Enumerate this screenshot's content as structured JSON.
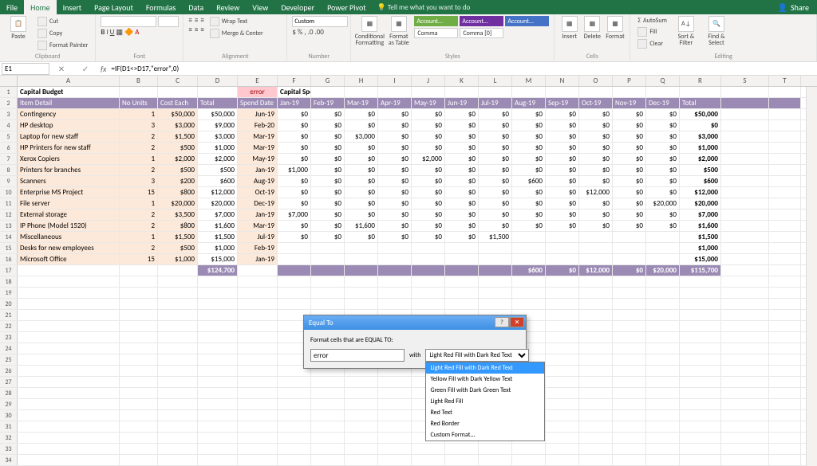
{
  "titlebar": {
    "tabs": [
      "File",
      "Home",
      "Insert",
      "Page Layout",
      "Formulas",
      "Data",
      "Review",
      "View",
      "Developer",
      "Power Pivot"
    ],
    "active_tab": 1,
    "tell_me": "Tell me what you want to do",
    "share": "Share"
  },
  "ribbon": {
    "clipboard": {
      "paste": "Paste",
      "cut": "Cut",
      "copy": "Copy",
      "format_painter": "Format Painter",
      "label": "Clipboard"
    },
    "font": {
      "label": "Font"
    },
    "alignment": {
      "wrap": "Wrap Text",
      "merge": "Merge & Center",
      "label": "Alignment"
    },
    "number": {
      "format": "Custom",
      "label": "Number"
    },
    "styles": {
      "cond_format": "Conditional Formatting",
      "format_table": "Format as Table",
      "accent_labels": [
        "Account...",
        "Account...",
        "Account...",
        "Comma",
        "Comma [0]"
      ],
      "accent_colors": [
        "#70ad47",
        "#7030a0",
        "#4472c4",
        "#ffffff",
        "#ffffff"
      ],
      "label": "Styles"
    },
    "cells": {
      "insert": "Insert",
      "delete": "Delete",
      "format": "Format",
      "label": "Cells"
    },
    "editing": {
      "autosum": "AutoSum",
      "fill": "Fill",
      "clear": "Clear",
      "sort": "Sort & Filter",
      "find": "Find & Select",
      "label": "Editing"
    }
  },
  "formula_bar": {
    "name": "E1",
    "formula": "=IF(D1<>D17,\"error\",0)"
  },
  "columns": [
    {
      "id": "A",
      "w": 128
    },
    {
      "id": "B",
      "w": 48
    },
    {
      "id": "C",
      "w": 50
    },
    {
      "id": "D",
      "w": 50
    },
    {
      "id": "E",
      "w": 50
    },
    {
      "id": "F",
      "w": 42
    },
    {
      "id": "G",
      "w": 42
    },
    {
      "id": "H",
      "w": 42
    },
    {
      "id": "I",
      "w": 42
    },
    {
      "id": "J",
      "w": 42
    },
    {
      "id": "K",
      "w": 42
    },
    {
      "id": "L",
      "w": 42
    },
    {
      "id": "M",
      "w": 42
    },
    {
      "id": "N",
      "w": 42
    },
    {
      "id": "O",
      "w": 42
    },
    {
      "id": "P",
      "w": 42
    },
    {
      "id": "Q",
      "w": 42
    },
    {
      "id": "R",
      "w": 52
    },
    {
      "id": "S",
      "w": 60
    },
    {
      "id": "T",
      "w": 40
    }
  ],
  "sheet": {
    "title_a": "Capital Budget",
    "title_f": "Capital Spend Schedule",
    "e1_error": "error",
    "headers": [
      "Item Detail",
      "No Units",
      "Cost Each",
      "Total",
      "Spend Date",
      "Jan-19",
      "Feb-19",
      "Mar-19",
      "Apr-19",
      "May-19",
      "Jun-19",
      "Jul-19",
      "Aug-19",
      "Sep-19",
      "Oct-19",
      "Nov-19",
      "Dec-19",
      "Total"
    ],
    "rows": [
      {
        "item": "Contingency",
        "units": 1,
        "cost": "$50,000",
        "total": "$50,000",
        "date": "Jun-19",
        "months": [
          "$0",
          "$0",
          "$0",
          "$0",
          "$0",
          "$0",
          "$0",
          "$0",
          "$0",
          "$0",
          "$0",
          "$0"
        ],
        "rtotal": "$50,000"
      },
      {
        "item": "HP desktop",
        "units": 3,
        "cost": "$3,000",
        "total": "$9,000",
        "date": "Feb-20",
        "months": [
          "$0",
          "$0",
          "$0",
          "$0",
          "$0",
          "$0",
          "$0",
          "$0",
          "$0",
          "$0",
          "$0",
          "$0"
        ],
        "rtotal": "$0"
      },
      {
        "item": "Laptop for new staff",
        "units": 2,
        "cost": "$1,500",
        "total": "$3,000",
        "date": "Mar-19",
        "months": [
          "$0",
          "$0",
          "$3,000",
          "$0",
          "$0",
          "$0",
          "$0",
          "$0",
          "$0",
          "$0",
          "$0",
          "$0"
        ],
        "rtotal": "$3,000"
      },
      {
        "item": "HP Printers for new staff",
        "units": 2,
        "cost": "$500",
        "total": "$1,000",
        "date": "Mar-19",
        "months": [
          "$0",
          "$0",
          "$0",
          "$0",
          "$0",
          "$0",
          "$0",
          "$0",
          "$0",
          "$0",
          "$0",
          "$0"
        ],
        "rtotal": "$1,000"
      },
      {
        "item": "Xerox Copiers",
        "units": 1,
        "cost": "$2,000",
        "total": "$2,000",
        "date": "May-19",
        "months": [
          "$0",
          "$0",
          "$0",
          "$0",
          "$2,000",
          "$0",
          "$0",
          "$0",
          "$0",
          "$0",
          "$0",
          "$0"
        ],
        "rtotal": "$2,000"
      },
      {
        "item": "Printers for branches",
        "units": 2,
        "cost": "$500",
        "total": "$500",
        "date": "Jan-19",
        "months": [
          "$1,000",
          "$0",
          "$0",
          "$0",
          "$0",
          "$0",
          "$0",
          "$0",
          "$0",
          "$0",
          "$0",
          "$0"
        ],
        "rtotal": "$500"
      },
      {
        "item": "Scanners",
        "units": 3,
        "cost": "$200",
        "total": "$600",
        "date": "Aug-19",
        "months": [
          "$0",
          "$0",
          "$0",
          "$0",
          "$0",
          "$0",
          "$0",
          "$600",
          "$0",
          "$0",
          "$0",
          "$0"
        ],
        "rtotal": "$600"
      },
      {
        "item": "Enterprise MS Project",
        "units": 15,
        "cost": "$800",
        "total": "$12,000",
        "date": "Oct-19",
        "months": [
          "$0",
          "$0",
          "$0",
          "$0",
          "$0",
          "$0",
          "$0",
          "$0",
          "$0",
          "$12,000",
          "$0",
          "$0"
        ],
        "rtotal": "$12,000"
      },
      {
        "item": "File server",
        "units": 1,
        "cost": "$20,000",
        "total": "$20,000",
        "date": "Dec-19",
        "months": [
          "$0",
          "$0",
          "$0",
          "$0",
          "$0",
          "$0",
          "$0",
          "$0",
          "$0",
          "$0",
          "$0",
          "$20,000"
        ],
        "rtotal": "$20,000"
      },
      {
        "item": "External storage",
        "units": 2,
        "cost": "$3,500",
        "total": "$7,000",
        "date": "Jan-19",
        "months": [
          "$7,000",
          "$0",
          "$0",
          "$0",
          "$0",
          "$0",
          "$0",
          "$0",
          "$0",
          "$0",
          "$0",
          "$0"
        ],
        "rtotal": "$7,000"
      },
      {
        "item": "IP Phone (Model 1520)",
        "units": 2,
        "cost": "$800",
        "total": "$1,600",
        "date": "Mar-19",
        "months": [
          "$0",
          "$0",
          "$1,600",
          "$0",
          "$0",
          "$0",
          "$0",
          "$0",
          "$0",
          "$0",
          "$0",
          "$0"
        ],
        "rtotal": "$1,600"
      },
      {
        "item": "Miscellaneous",
        "units": 1,
        "cost": "$1,500",
        "total": "$1,500",
        "date": "Jul-19",
        "months": [
          "$0",
          "$0",
          "$0",
          "$0",
          "$0",
          "$0",
          "$1,500",
          "",
          "",
          "",
          "",
          ""
        ],
        "rtotal": "$1,500"
      },
      {
        "item": "Desks for new employees",
        "units": 2,
        "cost": "$500",
        "total": "$1,000",
        "date": "Feb-19",
        "months": [
          "",
          "",
          "",
          "",
          "",
          "",
          "",
          "",
          "",
          "",
          "",
          ""
        ],
        "rtotal": "$1,000"
      },
      {
        "item": "Microsoft Office",
        "units": 15,
        "cost": "$1,000",
        "total": "$15,000",
        "date": "Jan-19",
        "months": [
          "",
          "",
          "",
          "",
          "",
          "",
          "",
          "",
          "",
          "",
          "",
          ""
        ],
        "rtotal": "$15,000"
      }
    ],
    "totals": {
      "d": "$124,700",
      "months": [
        "",
        "",
        "",
        "",
        "",
        "",
        "",
        "$600",
        "$0",
        "$12,000",
        "$0",
        "$20,000"
      ],
      "r": "$115,700"
    }
  },
  "dialog": {
    "title": "Equal To",
    "prompt": "Format cells that are EQUAL TO:",
    "value": "error",
    "with": "with",
    "selected": "Light Red Fill with Dark Red Text",
    "options": [
      "Light Red Fill with Dark Red Text",
      "Yellow Fill with Dark Yellow Text",
      "Green Fill with Dark Green Text",
      "Light Red Fill",
      "Red Text",
      "Red Border",
      "Custom Format..."
    ]
  }
}
